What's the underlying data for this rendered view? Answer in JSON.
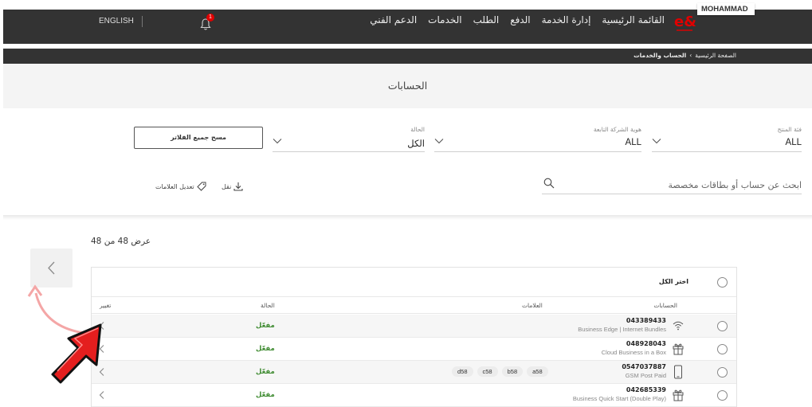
{
  "header": {
    "language": "ENGLISH",
    "notification_count": "1",
    "nav": [
      "القائمة الرئيسية",
      "إدارة الخدمة",
      "الدفع",
      "الطلب",
      "الخدمات",
      "الدعم الفني"
    ],
    "user_name": "MOHAMMAD"
  },
  "breadcrumb": {
    "home": "الصفحة الرئيسية",
    "separator": "›",
    "current": "الحساب والخدمات"
  },
  "page_title": "الحسابات",
  "filters": {
    "product": {
      "label": "فئة المنتج",
      "value": "ALL"
    },
    "company": {
      "label": "هوية الشركة التابعة",
      "value": "ALL"
    },
    "status": {
      "label": "الحالة",
      "value": "الكل"
    },
    "clear_label": "مسح جميع الفلاتر"
  },
  "search": {
    "placeholder": "ابحث عن حساب أو بطاقات مخصصة"
  },
  "actions": {
    "download_label": "نقل",
    "edit_tags_label": "تعديل العلامات"
  },
  "results_count": "عرض 48 من 48",
  "table": {
    "select_all": "اختر الكل",
    "headers": {
      "accounts": "الحسابات",
      "tags": "العلامات",
      "status": "الحالة",
      "change": "تغيير"
    },
    "rows": [
      {
        "number": "043389433",
        "desc": "Business Edge | Internet Bundles",
        "icon": "wifi-icon",
        "tags": [],
        "status": "مفعّل"
      },
      {
        "number": "048928043",
        "desc": "Cloud Business in a Box",
        "icon": "gift-box-icon",
        "tags": [],
        "status": "مفعّل"
      },
      {
        "number": "0547037887",
        "desc": "GSM Post Paid",
        "icon": "mobile-phone-icon",
        "tags": [
          "a58",
          "b58",
          "c58",
          "d58"
        ],
        "status": "مفعّل"
      },
      {
        "number": "042685339",
        "desc": "Business Quick Start (Double Play)",
        "icon": "gift-box-icon",
        "tags": [],
        "status": "مفعّل"
      }
    ]
  },
  "colors": {
    "topbar": "#333333",
    "brand_red": "#e00000",
    "active_green": "#3d8a2f",
    "annotation_arrow": "#f06a6a"
  }
}
